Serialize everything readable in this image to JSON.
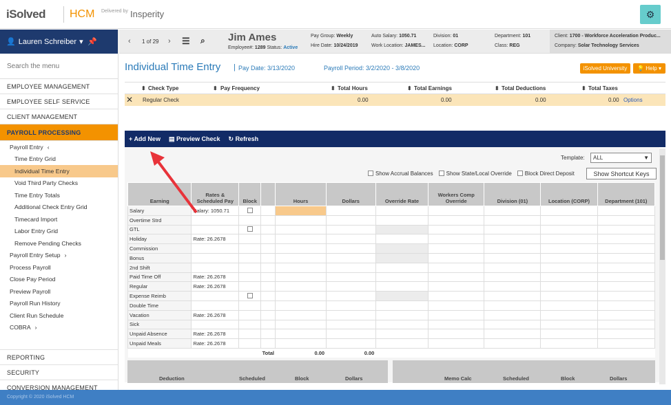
{
  "brand": {
    "logo": "iSolved",
    "hcm": "HCM",
    "delivered_by": "Delivered by",
    "partner": "Insperity"
  },
  "sidebar": {
    "user": "Lauren Schreiber",
    "search_placeholder": "Search the menu",
    "sections_top": [
      "EMPLOYEE MANAGEMENT",
      "EMPLOYEE SELF SERVICE",
      "CLIENT MANAGEMENT"
    ],
    "active_section": "PAYROLL PROCESSING",
    "items": [
      {
        "label": "Payroll Entry",
        "level": 1,
        "arrow": "‹"
      },
      {
        "label": "Time Entry Grid",
        "level": 2
      },
      {
        "label": "Individual Time Entry",
        "level": 2,
        "selected": true
      },
      {
        "label": "Void Third Party Checks",
        "level": 2
      },
      {
        "label": "Time Entry Totals",
        "level": 2
      },
      {
        "label": "Additional Check Entry Grid",
        "level": 2
      },
      {
        "label": "Timecard Import",
        "level": 2
      },
      {
        "label": "Labor Entry Grid",
        "level": 2
      },
      {
        "label": "Remove Pending Checks",
        "level": 2
      },
      {
        "label": "Payroll Entry Setup",
        "level": 1,
        "arrow": "›"
      },
      {
        "label": "Process Payroll",
        "level": 1
      },
      {
        "label": "Close Pay Period",
        "level": 1
      },
      {
        "label": "Preview Payroll",
        "level": 1
      },
      {
        "label": "Payroll Run History",
        "level": 1
      },
      {
        "label": "Client Run Schedule",
        "level": 1
      },
      {
        "label": "COBRA",
        "level": 1,
        "arrow": "›"
      }
    ],
    "sections_bottom": [
      "REPORTING",
      "SECURITY",
      "CONVERSION MANAGEMENT"
    ]
  },
  "employee_bar": {
    "pager": "1 of 29",
    "name": "Jim Ames",
    "employee_label": "Employee#:",
    "employee_no": "1289",
    "status_label": "Status:",
    "status": "Active",
    "pay_group_label": "Pay Group:",
    "pay_group": "Weekly",
    "hire_date_label": "Hire Date:",
    "hire_date": "10/24/2019",
    "auto_salary_label": "Auto Salary:",
    "auto_salary": "1050.71",
    "work_location_label": "Work Location:",
    "work_location": "JAMES...",
    "division_label": "Division:",
    "division": "01",
    "location_label": "Location:",
    "location": "CORP",
    "department_label": "Department:",
    "department": "101",
    "class_label": "Class:",
    "class": "REG",
    "client_label": "Client:",
    "client": "1700 - Workforce Acceleration Produc...",
    "company_label": "Company:",
    "company": "Solar Technology Services"
  },
  "page": {
    "title": "Individual Time Entry",
    "pay_date": "Pay Date: 3/13/2020",
    "payroll_period": "Payroll Period: 3/2/2020 - 3/8/2020",
    "university_btn": "iSolved University",
    "help_btn": "Help"
  },
  "check_table": {
    "headers": [
      "Check Type",
      "Pay Frequency",
      "Total Hours",
      "Total Earnings",
      "Total Deductions",
      "Total Taxes"
    ],
    "row": {
      "type": "Regular Check",
      "freq": "",
      "hours": "0.00",
      "earnings": "0.00",
      "deductions": "0.00",
      "taxes": "0.00",
      "options": "Options"
    }
  },
  "toolbar": {
    "add": "Add New",
    "preview": "Preview Check",
    "refresh": "Refresh"
  },
  "grid": {
    "template_label": "Template:",
    "template_value": "ALL",
    "opt_accrual": "Show Accrual Balances",
    "opt_state": "Show State/Local Override",
    "opt_block": "Block Direct Deposit",
    "shortcut_btn": "Show Shortcut Keys",
    "headers": [
      "Earning",
      "Rates & Scheduled Pay",
      "Block",
      "",
      "Hours",
      "Dollars",
      "Override Rate",
      "Workers Comp Override",
      "Division (01)",
      "Location (CORP)",
      "Department (101)"
    ],
    "rows": [
      {
        "earning": "Salary",
        "rate": "Salary: 1050.71",
        "block": true,
        "gray": false
      },
      {
        "earning": "Overtime Strd",
        "rate": "",
        "block": false,
        "gray": false
      },
      {
        "earning": "GTL",
        "rate": "",
        "block": true,
        "gray": true
      },
      {
        "earning": "Holiday",
        "rate": "Rate: 26.2678",
        "block": false,
        "gray": false
      },
      {
        "earning": "Commission",
        "rate": "",
        "block": false,
        "gray": true
      },
      {
        "earning": "Bonus",
        "rate": "",
        "block": false,
        "gray": true
      },
      {
        "earning": "2nd Shift",
        "rate": "",
        "block": false,
        "gray": false
      },
      {
        "earning": "Paid Time Off",
        "rate": "Rate: 26.2678",
        "block": false,
        "gray": false
      },
      {
        "earning": "Regular",
        "rate": "Rate: 26.2678",
        "block": false,
        "gray": false
      },
      {
        "earning": "Expense Reimb",
        "rate": "",
        "block": true,
        "gray": true
      },
      {
        "earning": "Double Time",
        "rate": "",
        "block": false,
        "gray": false
      },
      {
        "earning": "Vacation",
        "rate": "Rate: 26.2678",
        "block": false,
        "gray": false
      },
      {
        "earning": "Sick",
        "rate": "",
        "block": false,
        "gray": false
      },
      {
        "earning": "Unpaid Absence",
        "rate": "Rate: 26.2678",
        "block": false,
        "gray": false
      },
      {
        "earning": "Unpaid Meals",
        "rate": "Rate: 26.2678",
        "block": false,
        "gray": false
      }
    ],
    "total_label": "Total",
    "total_hours": "0.00",
    "total_dollars": "0.00",
    "deduction_headers": [
      "Deduction",
      "Scheduled",
      "Block",
      "Dollars"
    ],
    "memo_headers": [
      "Memo Calc",
      "Scheduled",
      "Block",
      "Dollars"
    ]
  },
  "footer": {
    "copyright": "Copyright © 2020 iSolved HCM"
  },
  "colors": {
    "orange": "#f39200",
    "navy": "#122b66",
    "blue_text": "#2a7ab8",
    "highlight": "#f8c98b"
  }
}
